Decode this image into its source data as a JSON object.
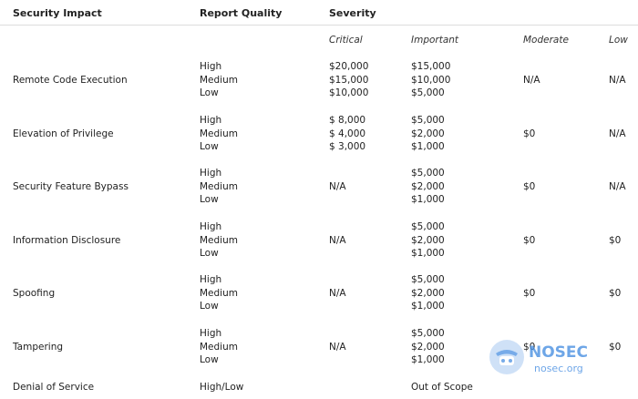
{
  "headers": {
    "impact": "Security Impact",
    "quality": "Report Quality",
    "severity": "Severity"
  },
  "severity_levels": [
    "Critical",
    "Important",
    "Moderate",
    "Low"
  ],
  "rows": [
    {
      "impact": "Remote Code Execution",
      "quality": [
        "High",
        "Medium",
        "Low"
      ],
      "critical": [
        "$20,000",
        "$15,000",
        "$10,000"
      ],
      "important": [
        "$15,000",
        "$10,000",
        "$5,000"
      ],
      "moderate": [
        "N/A"
      ],
      "low": [
        "N/A"
      ]
    },
    {
      "impact": "Elevation of Privilege",
      "quality": [
        "High",
        "Medium",
        "Low"
      ],
      "critical": [
        "$ 8,000",
        "$ 4,000",
        "$ 3,000"
      ],
      "important": [
        "$5,000",
        "$2,000",
        "$1,000"
      ],
      "moderate": [
        "$0"
      ],
      "low": [
        "N/A"
      ]
    },
    {
      "impact": "Security Feature Bypass",
      "quality": [
        "High",
        "Medium",
        "Low"
      ],
      "critical": [
        "N/A"
      ],
      "important": [
        "$5,000",
        "$2,000",
        "$1,000"
      ],
      "moderate": [
        "$0"
      ],
      "low": [
        "N/A"
      ]
    },
    {
      "impact": "Information Disclosure",
      "quality": [
        "High",
        "Medium",
        "Low"
      ],
      "critical": [
        "N/A"
      ],
      "important": [
        "$5,000",
        "$2,000",
        "$1,000"
      ],
      "moderate": [
        "$0"
      ],
      "low": [
        "$0"
      ]
    },
    {
      "impact": "Spoofing",
      "quality": [
        "High",
        "Medium",
        "Low"
      ],
      "critical": [
        "N/A"
      ],
      "important": [
        "$5,000",
        "$2,000",
        "$1,000"
      ],
      "moderate": [
        "$0"
      ],
      "low": [
        "$0"
      ]
    },
    {
      "impact": "Tampering",
      "quality": [
        "High",
        "Medium",
        "Low"
      ],
      "critical": [
        "N/A"
      ],
      "important": [
        "$5,000",
        "$2,000",
        "$1,000"
      ],
      "moderate": [
        "$0"
      ],
      "low": [
        "$0"
      ]
    }
  ],
  "last_row": {
    "impact": "Denial of Service",
    "quality": "High/Low",
    "important": "Out of Scope"
  },
  "watermark": {
    "brand": "NOSEC",
    "domain": "nosec.org",
    "color": "#4a90e2"
  }
}
